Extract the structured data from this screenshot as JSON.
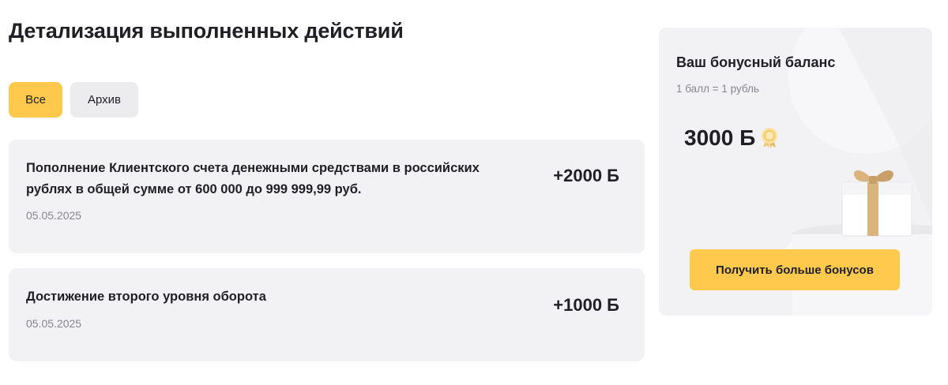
{
  "page": {
    "title": "Детализация выполненных действий"
  },
  "tabs": [
    {
      "label": "Все",
      "active": true
    },
    {
      "label": "Архив",
      "active": false
    }
  ],
  "activities": [
    {
      "title": "Пополнение Клиентского счета денежными средствами в российских рублях в общей сумме от 600 000 до 999 999,99 руб.",
      "date": "05.05.2025",
      "amount": "+2000 Б"
    },
    {
      "title": "Достижение второго уровня оборота",
      "date": "05.05.2025",
      "amount": "+1000 Б"
    }
  ],
  "bonus": {
    "title": "Ваш бонусный баланс",
    "rate": "1 балл = 1 рубль",
    "amount": "3000 Б",
    "icon": "medal-icon",
    "illustration": "gift-icon",
    "button_label": "Получить больше бонусов"
  },
  "colors": {
    "accent": "#ffc94d",
    "card_bg": "#f2f2f5",
    "tab_inactive": "#ececef",
    "text": "#1f1f24",
    "muted": "#86868c"
  }
}
